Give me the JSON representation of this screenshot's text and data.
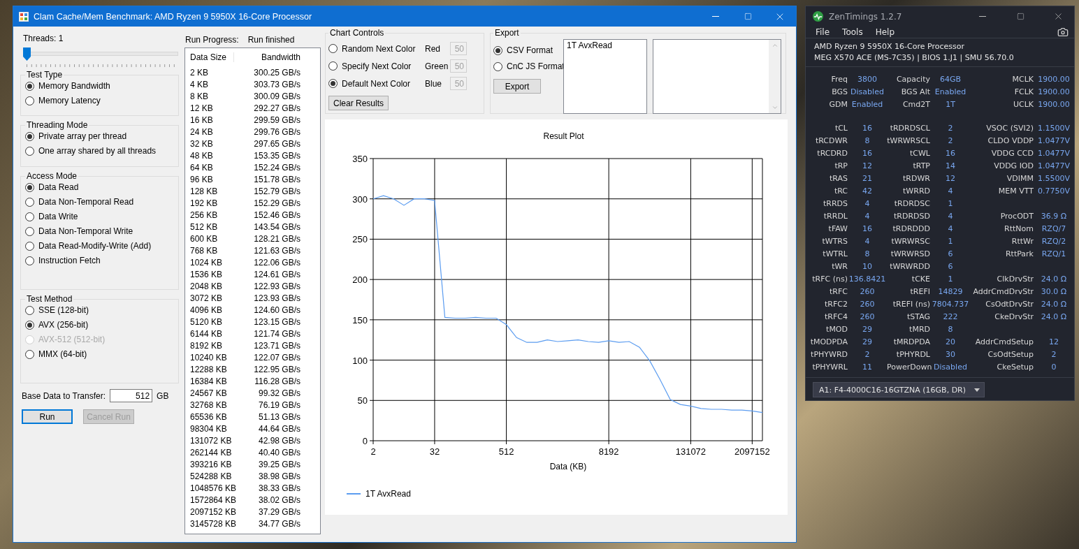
{
  "benchmark_window": {
    "title": "Clam Cache/Mem Benchmark: AMD Ryzen 9 5950X 16-Core Processor",
    "threads": {
      "label": "Threads: 1",
      "level": 0
    },
    "groups": [
      {
        "title": "Test Type",
        "options": [
          {
            "label": "Memory Bandwidth",
            "selected": true
          },
          {
            "label": "Memory Latency",
            "selected": false
          }
        ]
      },
      {
        "title": "Threading Mode",
        "options": [
          {
            "label": "Private array per thread",
            "selected": true
          },
          {
            "label": "One array shared by all threads",
            "selected": false
          }
        ]
      },
      {
        "title": "Access Mode",
        "options": [
          {
            "label": "Data Read",
            "selected": true
          },
          {
            "label": "Data Non-Temporal Read",
            "selected": false
          },
          {
            "label": "Data Write",
            "selected": false
          },
          {
            "label": "Data Non-Temporal Write",
            "selected": false
          },
          {
            "label": "Data Read-Modify-Write (Add)",
            "selected": false
          },
          {
            "label": "Instruction Fetch",
            "selected": false
          }
        ]
      },
      {
        "title": "Test Method",
        "options": [
          {
            "label": "SSE (128-bit)",
            "selected": false,
            "disabled": false
          },
          {
            "label": "AVX (256-bit)",
            "selected": true,
            "disabled": false
          },
          {
            "label": "AVX-512 (512-bit)",
            "selected": false,
            "disabled": true
          },
          {
            "label": "MMX (64-bit)",
            "selected": false,
            "disabled": false
          }
        ]
      }
    ],
    "base_data": {
      "label": "Base Data to Transfer:",
      "value": "512",
      "unit": "GB"
    },
    "buttons": [
      {
        "label": "Run",
        "disabled": false,
        "focused": true
      },
      {
        "label": "Cancel Run",
        "disabled": true,
        "focused": false
      }
    ],
    "run_progress": {
      "label": "Run Progress:",
      "status": "Run finished"
    },
    "results_table": {
      "columns": [
        "Data Size",
        "Bandwidth"
      ],
      "rows": [
        [
          "2 KB",
          "300.25 GB/s"
        ],
        [
          "4 KB",
          "303.73 GB/s"
        ],
        [
          "8 KB",
          "300.09 GB/s"
        ],
        [
          "12 KB",
          "292.27 GB/s"
        ],
        [
          "16 KB",
          "299.59 GB/s"
        ],
        [
          "24 KB",
          "299.76 GB/s"
        ],
        [
          "32 KB",
          "297.65 GB/s"
        ],
        [
          "48 KB",
          "153.35 GB/s"
        ],
        [
          "64 KB",
          "152.24 GB/s"
        ],
        [
          "96 KB",
          "151.78 GB/s"
        ],
        [
          "128 KB",
          "152.79 GB/s"
        ],
        [
          "192 KB",
          "152.29 GB/s"
        ],
        [
          "256 KB",
          "152.46 GB/s"
        ],
        [
          "512 KB",
          "143.54 GB/s"
        ],
        [
          "600 KB",
          "128.21 GB/s"
        ],
        [
          "768 KB",
          "121.63 GB/s"
        ],
        [
          "1024 KB",
          "122.06 GB/s"
        ],
        [
          "1536 KB",
          "124.61 GB/s"
        ],
        [
          "2048 KB",
          "122.93 GB/s"
        ],
        [
          "3072 KB",
          "123.93 GB/s"
        ],
        [
          "4096 KB",
          "124.60 GB/s"
        ],
        [
          "5120 KB",
          "123.15 GB/s"
        ],
        [
          "6144 KB",
          "121.74 GB/s"
        ],
        [
          "8192 KB",
          "123.71 GB/s"
        ],
        [
          "10240 KB",
          "122.07 GB/s"
        ],
        [
          "12288 KB",
          "122.95 GB/s"
        ],
        [
          "16384 KB",
          "116.28 GB/s"
        ],
        [
          "24567 KB",
          "99.32 GB/s"
        ],
        [
          "32768 KB",
          "76.19 GB/s"
        ],
        [
          "65536 KB",
          "51.13 GB/s"
        ],
        [
          "98304 KB",
          "44.64 GB/s"
        ],
        [
          "131072 KB",
          "42.98 GB/s"
        ],
        [
          "262144 KB",
          "40.40 GB/s"
        ],
        [
          "393216 KB",
          "39.25 GB/s"
        ],
        [
          "524288 KB",
          "38.98 GB/s"
        ],
        [
          "1048576 KB",
          "38.33 GB/s"
        ],
        [
          "1572864 KB",
          "38.02 GB/s"
        ],
        [
          "2097152 KB",
          "37.29 GB/s"
        ],
        [
          "3145728 KB",
          "34.77 GB/s"
        ]
      ]
    },
    "chart_controls": {
      "title": "Chart Controls",
      "options": [
        {
          "label": "Random Next Color",
          "selected": false
        },
        {
          "label": "Specify Next Color",
          "selected": false
        },
        {
          "label": "Default Next Color",
          "selected": true
        }
      ],
      "colors": [
        {
          "label": "Red",
          "value": "50",
          "disabled": true
        },
        {
          "label": "Green",
          "value": "50",
          "disabled": true
        },
        {
          "label": "Blue",
          "value": "50",
          "disabled": true
        }
      ],
      "button": "Clear Results"
    },
    "export": {
      "title": "Export",
      "options": [
        {
          "label": "CSV Format",
          "selected": true
        },
        {
          "label": "CnC JS Format",
          "selected": false
        }
      ],
      "button": "Export",
      "results_list": [
        "1T AvxRead"
      ]
    },
    "plot": {
      "chart_data": {
        "type": "line",
        "title": "Result Plot",
        "xlabel": "Data (KB)",
        "categories": [
          "2",
          null,
          null,
          null,
          null,
          null,
          "32",
          null,
          null,
          null,
          null,
          null,
          null,
          "512",
          null,
          null,
          null,
          null,
          null,
          null,
          null,
          null,
          null,
          "8192",
          null,
          null,
          null,
          null,
          null,
          null,
          null,
          "131072",
          null,
          null,
          null,
          null,
          null,
          "2097152",
          null
        ],
        "series": [
          {
            "name": "1T AvxRead",
            "color": "#5b9cf0",
            "values": [
              300,
              304,
              300,
              292,
              300,
              300,
              298,
              153,
              152,
              152,
              153,
              152,
              152,
              144,
              128,
              122,
              122,
              125,
              123,
              124,
              125,
              123,
              122,
              124,
              122,
              123,
              116,
              99,
              76,
              51,
              45,
              43,
              40,
              39,
              39,
              38,
              38,
              37,
              35
            ]
          }
        ],
        "grid": true,
        "ylim": [
          0,
          350
        ],
        "yticks": [
          0,
          50,
          100,
          150,
          200,
          250,
          300,
          350
        ]
      }
    }
  },
  "zentimings_window": {
    "title": "ZenTimings 1.2.7",
    "menu": [
      "File",
      "Tools",
      "Help"
    ],
    "cpu": "AMD Ryzen 9 5950X 16-Core Processor",
    "board": "MEG X570 ACE (MS-7C35) | BIOS 1.J1 | SMU 56.70.0",
    "sections": [
      [
        [
          [
            "Freq",
            "3800"
          ],
          [
            "Capacity",
            "64GB"
          ],
          [
            "MCLK",
            "1900.00"
          ]
        ],
        [
          [
            "BGS",
            "Disabled"
          ],
          [
            "BGS Alt",
            "Enabled"
          ],
          [
            "FCLK",
            "1900.00"
          ]
        ],
        [
          [
            "GDM",
            "Enabled"
          ],
          [
            "Cmd2T",
            "1T"
          ],
          [
            "UCLK",
            "1900.00"
          ]
        ]
      ],
      [
        [
          [
            "tCL",
            "16"
          ],
          [
            "tRDRDSCL",
            "2"
          ],
          [
            "VSOC (SVI2)",
            "1.1500V"
          ]
        ],
        [
          [
            "tRCDWR",
            "8"
          ],
          [
            "tWRWRSCL",
            "2"
          ],
          [
            "CLDO VDDP",
            "1.0477V"
          ]
        ],
        [
          [
            "tRCDRD",
            "16"
          ],
          [
            "tCWL",
            "16"
          ],
          [
            "VDDG CCD",
            "1.0477V"
          ]
        ],
        [
          [
            "tRP",
            "12"
          ],
          [
            "tRTP",
            "14"
          ],
          [
            "VDDG IOD",
            "1.0477V"
          ]
        ],
        [
          [
            "tRAS",
            "21"
          ],
          [
            "tRDWR",
            "12"
          ],
          [
            "VDIMM",
            "1.5500V"
          ]
        ],
        [
          [
            "tRC",
            "42"
          ],
          [
            "tWRRD",
            "4"
          ],
          [
            "MEM VTT",
            "0.7750V"
          ]
        ],
        [
          [
            "tRRDS",
            "4"
          ],
          [
            "tRDRDSC",
            "1"
          ]
        ],
        [
          [
            "tRRDL",
            "4"
          ],
          [
            "tRDRDSD",
            "4"
          ],
          [
            "ProcODT",
            "36.9 Ω"
          ]
        ],
        [
          [
            "tFAW",
            "16"
          ],
          [
            "tRDRDDD",
            "4"
          ],
          [
            "RttNom",
            "RZQ/7"
          ]
        ],
        [
          [
            "tWTRS",
            "4"
          ],
          [
            "tWRWRSC",
            "1"
          ],
          [
            "RttWr",
            "RZQ/2"
          ]
        ],
        [
          [
            "tWTRL",
            "8"
          ],
          [
            "tWRWRSD",
            "6"
          ],
          [
            "RttPark",
            "RZQ/1"
          ]
        ],
        [
          [
            "tWR",
            "10"
          ],
          [
            "tWRWRDD",
            "6"
          ]
        ],
        [
          [
            "tRFC (ns)",
            "136.8421"
          ],
          [
            "tCKE",
            "1"
          ],
          [
            "ClkDrvStr",
            "24.0 Ω"
          ]
        ],
        [
          [
            "tRFC",
            "260"
          ],
          [
            "tREFI",
            "14829"
          ],
          [
            "AddrCmdDrvStr",
            "30.0 Ω"
          ]
        ],
        [
          [
            "tRFC2",
            "260"
          ],
          [
            "tREFI (ns)",
            "7804.737"
          ],
          [
            "CsOdtDrvStr",
            "24.0 Ω"
          ]
        ],
        [
          [
            "tRFC4",
            "260"
          ],
          [
            "tSTAG",
            "222"
          ],
          [
            "CkeDrvStr",
            "24.0 Ω"
          ]
        ],
        [
          [
            "tMOD",
            "29"
          ],
          [
            "tMRD",
            "8"
          ]
        ],
        [
          [
            "tMODPDA",
            "29"
          ],
          [
            "tMRDPDA",
            "20"
          ],
          [
            "AddrCmdSetup",
            "12"
          ]
        ],
        [
          [
            "tPHYWRD",
            "2"
          ],
          [
            "tPHYRDL",
            "30"
          ],
          [
            "CsOdtSetup",
            "2"
          ]
        ],
        [
          [
            "tPHYWRL",
            "11"
          ],
          [
            "PowerDown",
            "Disabled"
          ],
          [
            "CkeSetup",
            "0"
          ]
        ]
      ]
    ],
    "module": "A1: F4-4000C16-16GTZNA (16GB, DR)"
  }
}
